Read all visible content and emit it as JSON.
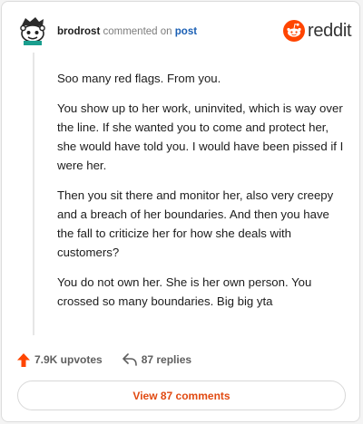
{
  "header": {
    "username": "brodrost",
    "action": "commented on",
    "post_type": "post",
    "logo_text": "reddit"
  },
  "comment": {
    "paragraphs": [
      "Soo many red flags. From you.",
      "You show up to her work, uninvited, which is way over the line. If she wanted you to come and protect her, she would have told you. I would have been pissed if I were her.",
      "Then you sit there and monitor her, also very creepy and a breach of her boundaries. And then you have the fall to criticize her for how she deals with customers?",
      "You do not own her. She is her own person. You crossed so many boundaries. Big big yta"
    ]
  },
  "footer": {
    "upvotes": "7.9K upvotes",
    "replies": "87 replies",
    "view_comments": "View 87 comments"
  },
  "colors": {
    "brand": "#ff4500",
    "link": "#1a5fb4",
    "view_button_text": "#e14a12"
  },
  "icons": {
    "avatar": "snoo-avatar-icon",
    "logo": "reddit-snoo-icon",
    "upvote": "upvote-arrow-icon",
    "reply": "reply-arrow-icon"
  }
}
